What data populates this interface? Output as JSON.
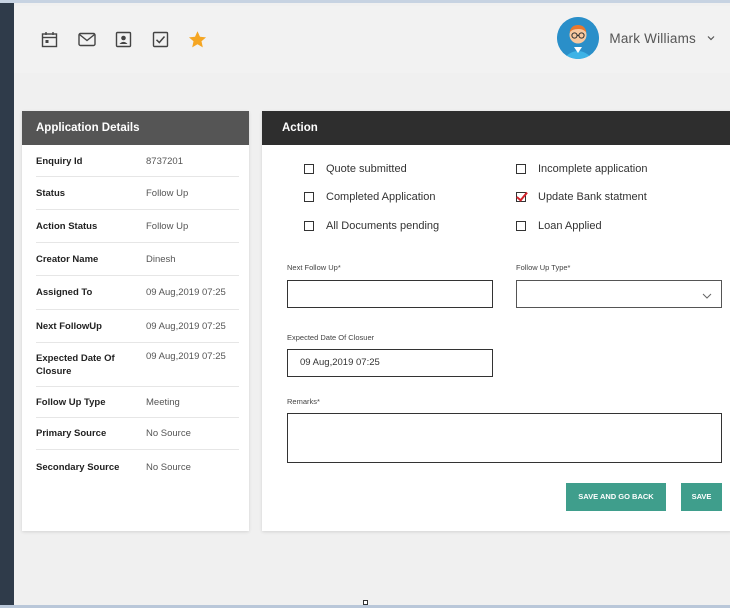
{
  "header": {
    "icons": [
      "calendar-icon",
      "mail-icon",
      "contact-icon",
      "checkbox-icon",
      "star-icon"
    ],
    "user_name": "Mark Williams"
  },
  "details": {
    "title": "Application Details",
    "rows": [
      {
        "label": "Enquiry Id",
        "value": "8737201"
      },
      {
        "label": "Status",
        "value": "Follow Up"
      },
      {
        "label": "Action Status",
        "value": "Follow Up"
      },
      {
        "label": "Creator Name",
        "value": "Dinesh"
      },
      {
        "label": "Assigned To",
        "value": "09 Aug,2019 07:25"
      },
      {
        "label": "Next FollowUp",
        "value": "09 Aug,2019 07:25"
      },
      {
        "label": "Expected Date Of Closure",
        "value": "09 Aug,2019 07:25"
      },
      {
        "label": "Follow Up Type",
        "value": "Meeting"
      },
      {
        "label": "Primary Source",
        "value": "No Source"
      },
      {
        "label": "Secondary Source",
        "value": "No Source"
      }
    ]
  },
  "action": {
    "title": "Action",
    "checkboxes": [
      {
        "label": "Quote submitted",
        "checked": false
      },
      {
        "label": "Incomplete application",
        "checked": false
      },
      {
        "label": "Completed Application",
        "checked": false
      },
      {
        "label": "Update Bank statment",
        "checked": true
      },
      {
        "label": "All Documents pending",
        "checked": false
      },
      {
        "label": "Loan Applied",
        "checked": false
      }
    ],
    "next_follow_up_label": "Next Follow Up*",
    "next_follow_up_value": "",
    "follow_up_type_label": "Follow Up Type*",
    "follow_up_type_value": "",
    "expected_closure_label": "Expected Date Of Closuer",
    "expected_closure_value": "09 Aug,2019 07:25",
    "remarks_label": "Remarks*",
    "remarks_value": "",
    "save_and_go_back": "SAVE AND GO BACK",
    "save": "SAVE"
  },
  "colors": {
    "details_header": "#555555",
    "action_header": "#2e2e2e",
    "button": "#3f9e8c",
    "star": "#f5a623",
    "check": "#d2232a"
  }
}
